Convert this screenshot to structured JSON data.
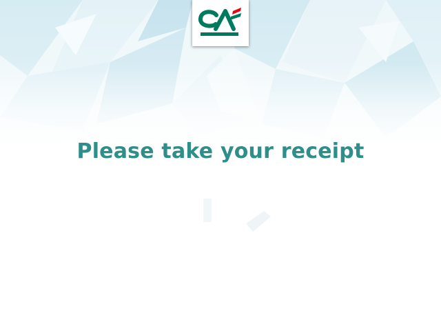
{
  "brand": {
    "logo_icon": "credit-agricole-logo-icon",
    "logo_colors": {
      "green": "#007a5e",
      "red": "#e30613",
      "tile": "#ffffff"
    }
  },
  "screen": {
    "message": "Please take your receipt",
    "message_color": "#2e8e8a",
    "background_colors": [
      "#d9eef4",
      "#eef7fa",
      "#ffffff"
    ]
  }
}
